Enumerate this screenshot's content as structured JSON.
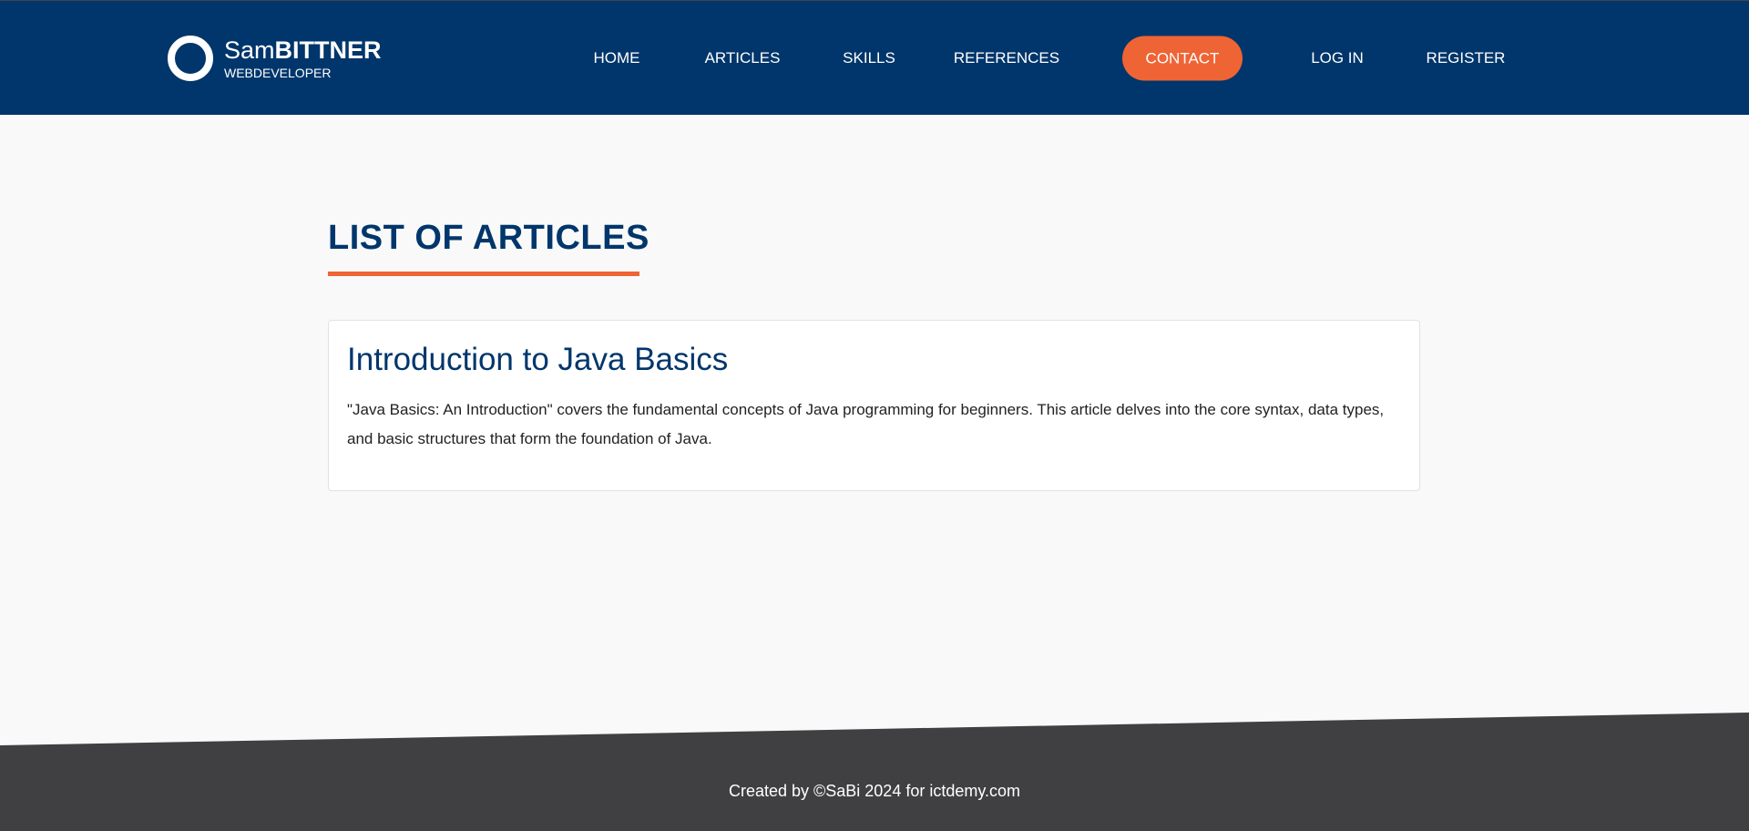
{
  "brand": {
    "first": "Sam",
    "last": "BITTNER",
    "subtitle": "WEBDEVELOPER"
  },
  "nav": [
    "HOME",
    "ARTICLES",
    "SKILLS",
    "REFERENCES",
    "CONTACT",
    "LOG IN",
    "REGISTER"
  ],
  "main": {
    "title": "LIST OF ARTICLES",
    "articles": [
      {
        "title": "Introduction to Java Basics",
        "summary": "\"Java Basics: An Introduction\" covers the fundamental concepts of Java programming for beginners. This article delves into the core syntax, data types, and basic structures that form the foundation of Java."
      }
    ]
  },
  "footer": {
    "text": "Created by ©SaBi 2024 for ictdemy.com"
  },
  "colors": {
    "primary": "#00366b",
    "accent": "#ef6434",
    "footer": "#404042"
  }
}
